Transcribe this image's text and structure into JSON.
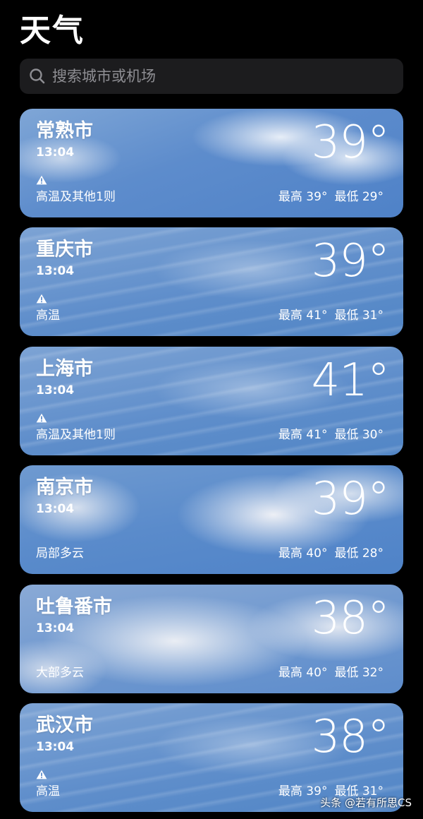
{
  "header": {
    "title": "天气"
  },
  "search": {
    "placeholder": "搜索城市或机场",
    "icon": "search-icon"
  },
  "cities": [
    {
      "name": "常熟市",
      "time": "13:04",
      "temperature": "39°",
      "warning": true,
      "condition": "高温及其他1则",
      "high": "最高 39°",
      "low": "最低 29°",
      "sky": "cloudy"
    },
    {
      "name": "重庆市",
      "time": "13:04",
      "temperature": "39°",
      "warning": true,
      "condition": "高温",
      "high": "最高 41°",
      "low": "最低 31°",
      "sky": "wispy"
    },
    {
      "name": "上海市",
      "time": "13:04",
      "temperature": "41°",
      "warning": true,
      "condition": "高温及其他1则",
      "high": "最高 41°",
      "low": "最低 30°",
      "sky": "wispy"
    },
    {
      "name": "南京市",
      "time": "13:04",
      "temperature": "39°",
      "warning": false,
      "condition": "局部多云",
      "high": "最高 40°",
      "low": "最低 28°",
      "sky": "bigcloud"
    },
    {
      "name": "吐鲁番市",
      "time": "13:04",
      "temperature": "38°",
      "warning": false,
      "condition": "大部多云",
      "high": "最高 40°",
      "low": "最低 32°",
      "sky": "overcast"
    },
    {
      "name": "武汉市",
      "time": "13:04",
      "temperature": "38°",
      "warning": true,
      "condition": "高温",
      "high": "最高 39°",
      "low": "最低 31°",
      "sky": "wispy"
    }
  ],
  "watermark": "头条 @若有所思CS",
  "colors": {
    "background": "#000000",
    "search_bg": "#1c1c1e",
    "placeholder": "#8e8e93",
    "card_sky": "#5d8ccc"
  }
}
